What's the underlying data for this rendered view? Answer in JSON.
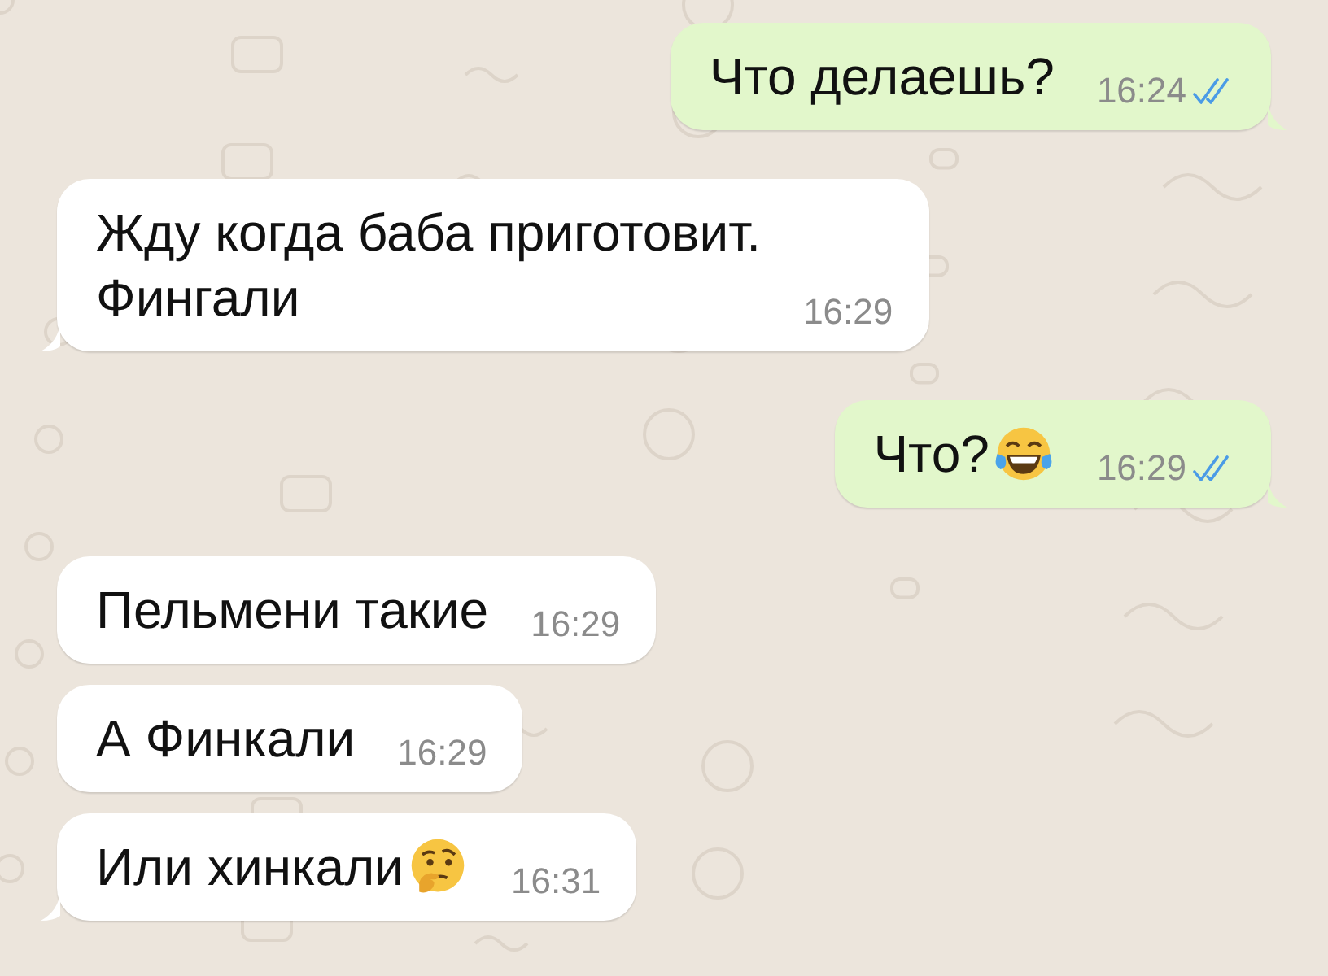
{
  "messages": [
    {
      "kind": "outgoing",
      "parts": [
        {
          "kind": "text",
          "text": "Что делаешь?"
        }
      ],
      "time": "16:24",
      "read": true
    },
    {
      "kind": "incoming",
      "parts": [
        {
          "kind": "text",
          "text": "Жду когда баба приготовит.\nФингали"
        }
      ],
      "time": "16:29"
    },
    {
      "kind": "outgoing",
      "parts": [
        {
          "kind": "text",
          "text": "Что?"
        },
        {
          "kind": "laughing_emoji"
        }
      ],
      "time": "16:29",
      "read": true
    },
    {
      "kind": "incoming",
      "parts": [
        {
          "kind": "text",
          "text": "Пельмени такие"
        }
      ],
      "time": "16:29"
    },
    {
      "kind": "incoming",
      "parts": [
        {
          "kind": "text",
          "text": "А Финкали"
        }
      ],
      "time": "16:29"
    },
    {
      "kind": "incoming",
      "parts": [
        {
          "kind": "text",
          "text": "Или  хинкали"
        },
        {
          "kind": "thinking_emoji"
        }
      ],
      "time": "16:31"
    }
  ]
}
